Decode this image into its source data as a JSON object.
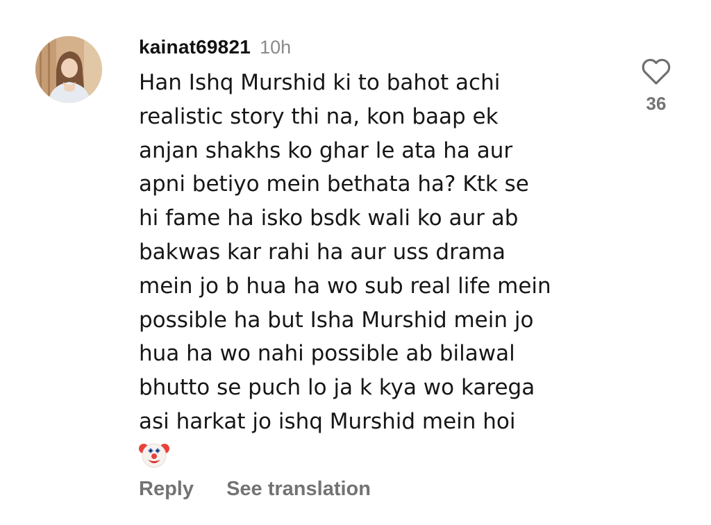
{
  "comment": {
    "username": "kainat69821",
    "timestamp": "10h",
    "text": "Han Ishq Murshid ki to bahot achi\nrealistic story thi na, kon baap ek\nanjan shakhs ko ghar le ata ha aur\napni betiyo mein bethata ha? Ktk se\nhi fame ha isko bsdk wali ko aur ab\nbakwas kar rahi ha aur uss drama\nmein jo b hua ha wo sub real life mein\npossible ha but Isha Murshid mein jo\nhua ha wo nahi possible ab bilawal\nbhutto se puch lo ja k kya wo karega\nasi harkat jo ishq Murshid mein hoi",
    "emoji": "clown-face-icon",
    "like_count": "36",
    "liked": false
  },
  "actions": {
    "reply_label": "Reply",
    "translate_label": "See translation"
  },
  "icons": {
    "avatar": "avatar",
    "like": "heart-outline-icon"
  }
}
